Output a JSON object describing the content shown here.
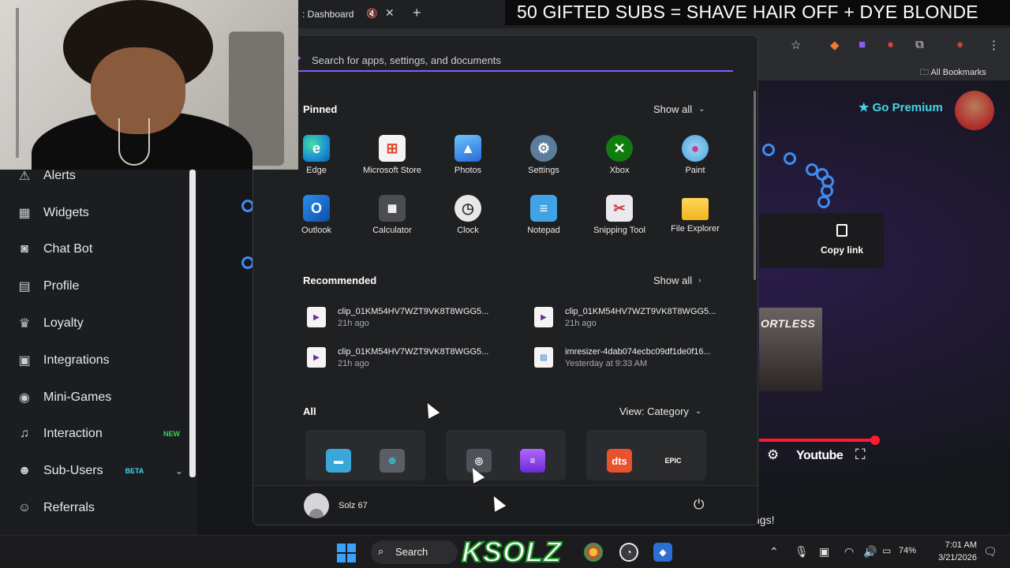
{
  "stream_banner": "50 GIFTED SUBS = SHAVE HAIR OFF + DYE BLONDE",
  "browser": {
    "tab_title": ": Dashboard",
    "bookmarks_label": "All Bookmarks"
  },
  "sidebar": {
    "items": [
      {
        "label": "Alerts",
        "icon": "warning-icon"
      },
      {
        "label": "Widgets",
        "icon": "grid-icon"
      },
      {
        "label": "Chat Bot",
        "icon": "robot-icon"
      },
      {
        "label": "Profile",
        "icon": "id-card-icon"
      },
      {
        "label": "Loyalty",
        "icon": "trophy-icon"
      },
      {
        "label": "Integrations",
        "icon": "puzzle-icon"
      },
      {
        "label": "Mini-Games",
        "icon": "gamepad-icon"
      },
      {
        "label": "Interaction",
        "icon": "music-icon",
        "badge": "NEW",
        "badge_color": "#39d353"
      },
      {
        "label": "Sub-Users",
        "icon": "users-icon",
        "badge": "BETA",
        "badge_color": "#43d6ea"
      },
      {
        "label": "Referrals",
        "icon": "people-icon"
      }
    ]
  },
  "dashboard": {
    "go_premium": "Go Premium",
    "copy_link": "Copy link",
    "album_text": "ORTLESS",
    "youtube_label": "Youtube",
    "bottom_text": "ngs!"
  },
  "start_menu": {
    "search_placeholder": "Search for apps, settings, and documents",
    "pinned_title": "Pinned",
    "show_all": "Show all",
    "pinned": [
      {
        "label": "Edge",
        "icon": "edge-icon",
        "color": "#1a8fd6"
      },
      {
        "label": "Microsoft Store",
        "icon": "store-icon",
        "color": "#f4f4f4"
      },
      {
        "label": "Photos",
        "icon": "photos-icon",
        "color": "#3b8ee8"
      },
      {
        "label": "Settings",
        "icon": "settings-icon",
        "color": "#5c7c9c"
      },
      {
        "label": "Xbox",
        "icon": "xbox-icon",
        "color": "#107c10"
      },
      {
        "label": "Paint",
        "icon": "paint-icon",
        "color": "#4aa3df"
      },
      {
        "label": "Outlook",
        "icon": "outlook-icon",
        "color": "#1066c4"
      },
      {
        "label": "Calculator",
        "icon": "calculator-icon",
        "color": "#4b4d52"
      },
      {
        "label": "Clock",
        "icon": "clock-icon",
        "color": "#d9d9d9"
      },
      {
        "label": "Notepad",
        "icon": "notepad-icon",
        "color": "#3fa3e6"
      },
      {
        "label": "Snipping Tool",
        "icon": "snipping-tool-icon",
        "color": "#e9e9ee"
      },
      {
        "label": "File Explorer",
        "icon": "folder-icon",
        "color": "#f2c12e"
      }
    ],
    "recommended_title": "Recommended",
    "recommended": [
      {
        "name": "clip_01KM54HV7WZT9VK8T8WGG5...",
        "time": "21h ago",
        "icon": "video-file-icon"
      },
      {
        "name": "clip_01KM54HV7WZT9VK8T8WGG5...",
        "time": "21h ago",
        "icon": "video-file-icon"
      },
      {
        "name": "clip_01KM54HV7WZT9VK8T8WGG5...",
        "time": "21h ago",
        "icon": "video-file-icon"
      },
      {
        "name": "imresizer-4dab074ecbc09df1de0f16...",
        "time": "Yesterday at 9:33 AM",
        "icon": "image-file-icon"
      }
    ],
    "all_title": "All",
    "view_category": "View: Category",
    "user_name": "Solz 67"
  },
  "taskbar": {
    "search_label": "Search",
    "overlay_logo": "KSOLZ",
    "battery": "74%",
    "time": "7:01 AM",
    "date": "3/21/2026"
  }
}
